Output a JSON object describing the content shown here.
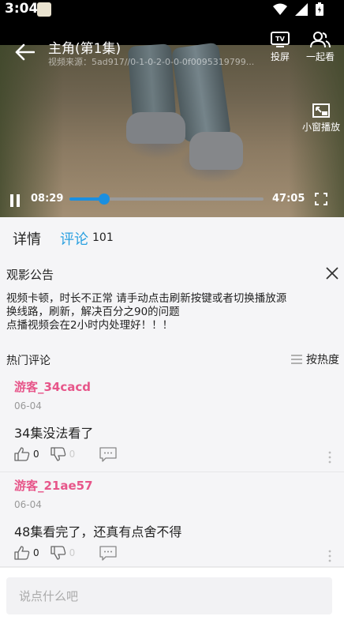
{
  "status_bar": {
    "time": "3:04"
  },
  "player": {
    "title": "主角(第1集)",
    "source": "视频来源：5ad917//0-1-0-2-0-0-0f0095319799...",
    "cast_label": "投屏",
    "watch_together_label": "一起看",
    "pip_label": "小窗播放",
    "current_time": "08:29",
    "total_time": "47:05",
    "progress_fraction": 0.18,
    "accent_color": "#1a8fe0"
  },
  "tabs": {
    "detail": "详情",
    "comments": "评论",
    "comment_count": "101"
  },
  "notice": {
    "title": "观影公告",
    "lines": [
      "视频卡顿，时长不正常 请手动点击刷新按键或者切换播放源",
      "换线路，刷新，解决百分之90的问题",
      "点播视频会在2小时内处理好！！！"
    ]
  },
  "hot_comments": {
    "title": "热门评论",
    "sort_label": "按热度"
  },
  "comments": [
    {
      "user": "游客_34cacd",
      "date": "06-04",
      "text": "34集没法看了",
      "likes": "0",
      "dislikes": "0"
    },
    {
      "user": "游客_21ae57",
      "date": "06-04",
      "text": "48集看完了，还真有点舍不得",
      "likes": "0",
      "dislikes": "0"
    }
  ],
  "input": {
    "placeholder": "说点什么吧"
  }
}
